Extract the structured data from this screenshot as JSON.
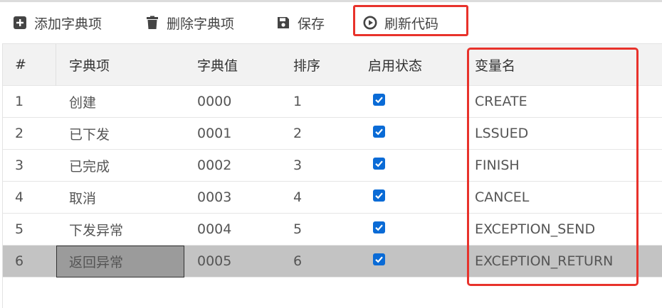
{
  "toolbar": {
    "add_label": "添加字典项",
    "delete_label": "删除字典项",
    "save_label": "保存",
    "refresh_label": "刷新代码"
  },
  "table": {
    "headers": [
      "#",
      "字典项",
      "字典值",
      "排序",
      "启用状态",
      "变量名"
    ],
    "rows": [
      {
        "index": "1",
        "item": "创建",
        "value": "0000",
        "sort": "1",
        "enabled": true,
        "var": "CREATE"
      },
      {
        "index": "2",
        "item": "已下发",
        "value": "0001",
        "sort": "2",
        "enabled": true,
        "var": "LSSUED"
      },
      {
        "index": "3",
        "item": "已完成",
        "value": "0002",
        "sort": "3",
        "enabled": true,
        "var": "FINISH"
      },
      {
        "index": "4",
        "item": "取消",
        "value": "0003",
        "sort": "4",
        "enabled": true,
        "var": "CANCEL"
      },
      {
        "index": "5",
        "item": "下发异常",
        "value": "0004",
        "sort": "5",
        "enabled": true,
        "var": "EXCEPTION_SEND"
      },
      {
        "index": "6",
        "item": "返回异常",
        "value": "0005",
        "sort": "6",
        "enabled": true,
        "var": "EXCEPTION_RETURN"
      }
    ]
  },
  "colors": {
    "highlight": "#e8322b",
    "checkbox": "#0a6bd6",
    "selected_row": "#c3c3c3"
  }
}
